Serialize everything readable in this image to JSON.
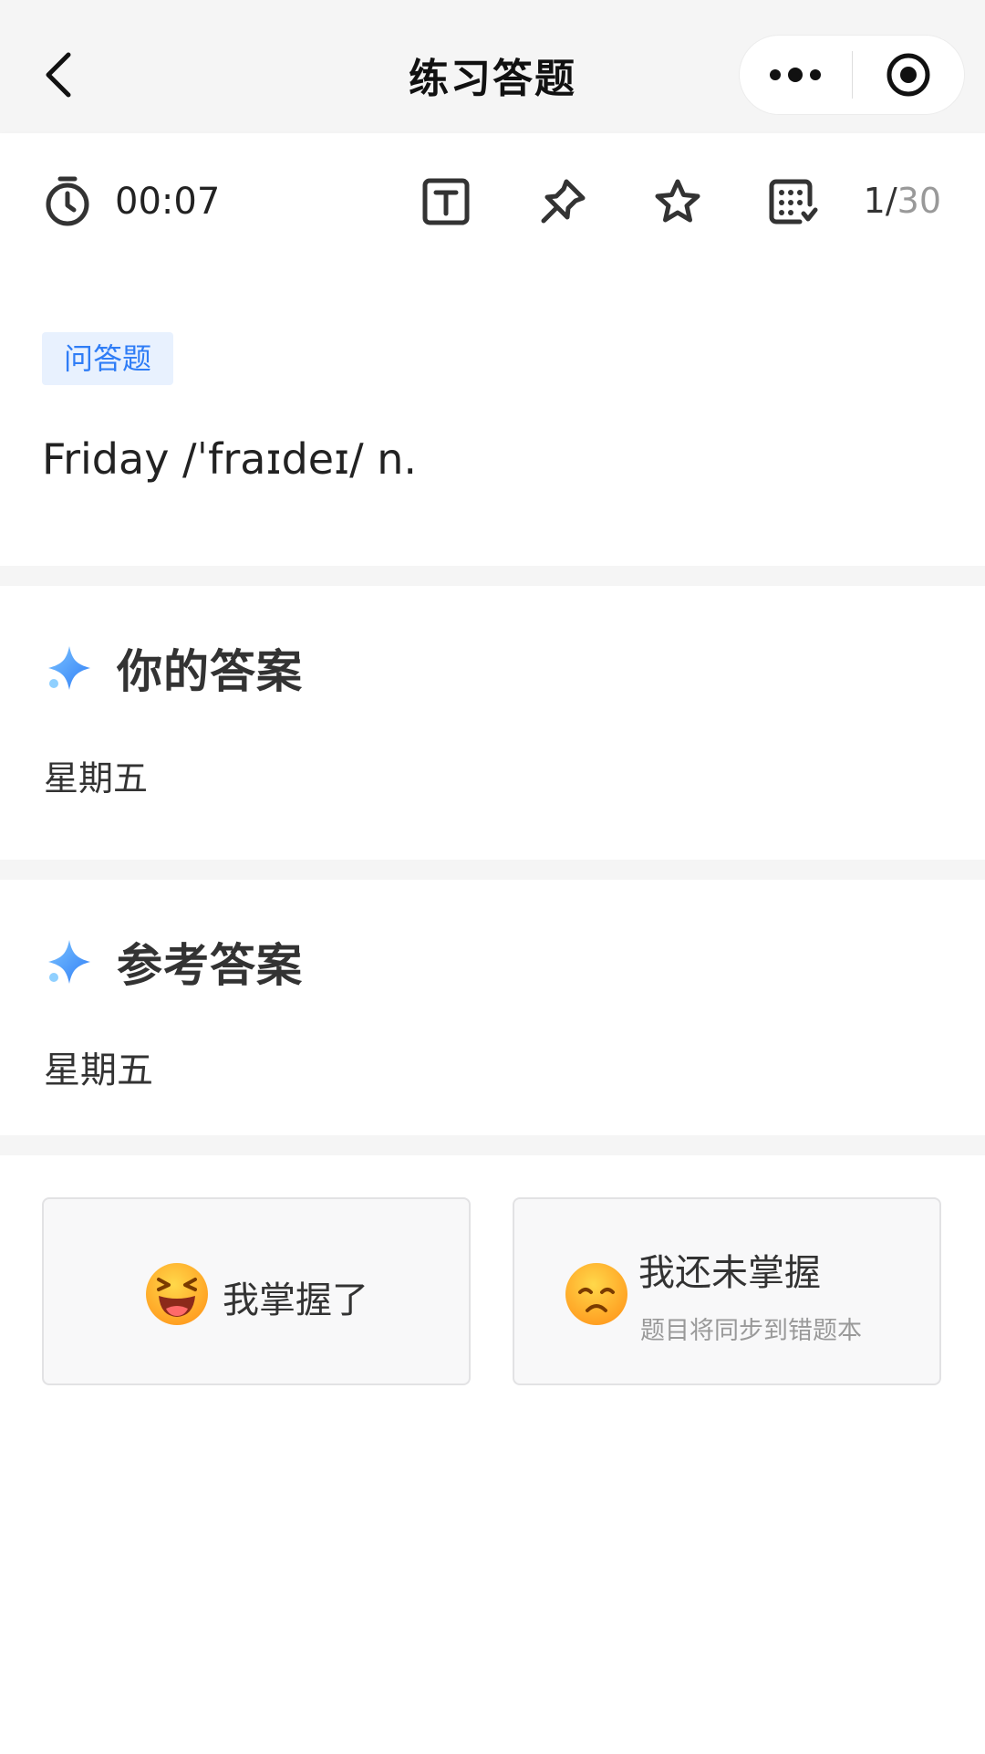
{
  "nav": {
    "title": "练习答题"
  },
  "toolbar": {
    "timer": "00:07",
    "progress_current": "1/",
    "progress_total": "30"
  },
  "question": {
    "tag": "问答题",
    "text": "Friday /ˈfraɪdeɪ/ n."
  },
  "your_answer": {
    "title": "你的答案",
    "value": "星期五"
  },
  "reference_answer": {
    "title": "参考答案",
    "value": "星期五"
  },
  "actions": {
    "mastered_label": "我掌握了",
    "not_mastered_label": "我还未掌握",
    "not_mastered_sub": "题目将同步到错题本"
  },
  "colors": {
    "accent_blue": "#2f7df6",
    "tag_bg": "#e8f1fe",
    "gap_bg": "#f5f5f5",
    "emoji_yellow": "#ffb21e"
  }
}
